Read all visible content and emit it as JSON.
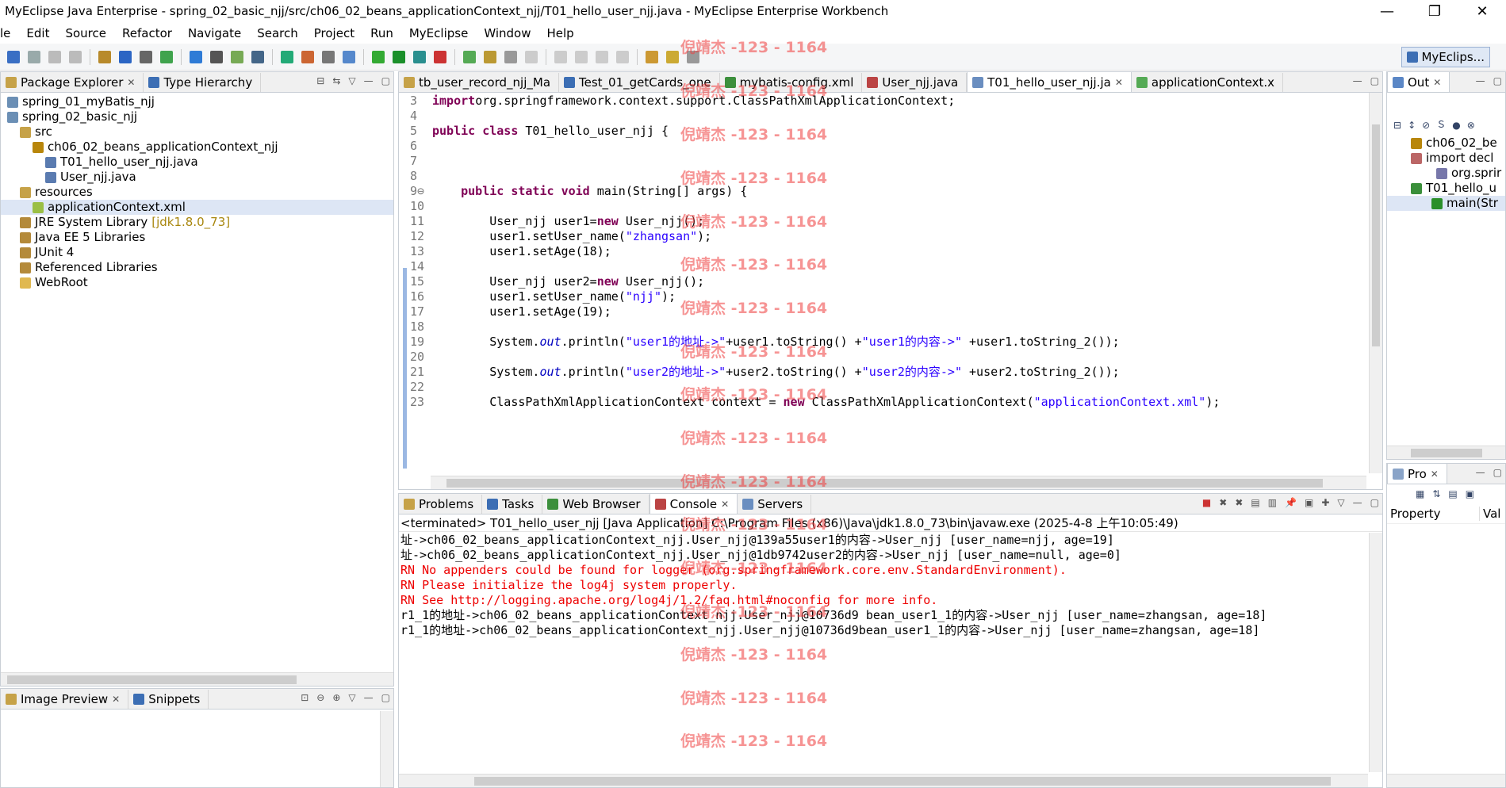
{
  "window": {
    "title": "MyEclipse Java Enterprise - spring_02_basic_njj/src/ch06_02_beans_applicationContext_njj/T01_hello_user_njj.java - MyEclipse Enterprise Workbench",
    "minimize": "—",
    "maximize": "❐",
    "close": "✕"
  },
  "menu": [
    "le",
    "Edit",
    "Source",
    "Refactor",
    "Navigate",
    "Search",
    "Project",
    "Run",
    "MyEclipse",
    "Window",
    "Help"
  ],
  "perspective": {
    "label": "MyEclips..."
  },
  "package_explorer": {
    "tabs": [
      {
        "label": "Package Explorer",
        "close": "✕"
      },
      {
        "label": "Type Hierarchy"
      }
    ],
    "tree": [
      {
        "label": "spring_01_myBatis_njj",
        "indent": 0,
        "icon": "project-icon"
      },
      {
        "label": "spring_02_basic_njj",
        "indent": 0,
        "icon": "project-icon"
      },
      {
        "label": "src",
        "indent": 1,
        "icon": "source-folder-icon"
      },
      {
        "label": "ch06_02_beans_applicationContext_njj",
        "indent": 2,
        "icon": "package-icon"
      },
      {
        "label": "T01_hello_user_njj.java",
        "indent": 3,
        "icon": "java-file-icon"
      },
      {
        "label": "User_njj.java",
        "indent": 3,
        "icon": "java-file-icon"
      },
      {
        "label": "resources",
        "indent": 1,
        "icon": "source-folder-icon"
      },
      {
        "label": "applicationContext.xml",
        "indent": 2,
        "icon": "xml-file-icon",
        "selected": true
      },
      {
        "label": "JRE System Library",
        "suffix": "[jdk1.8.0_73]",
        "indent": 1,
        "icon": "library-icon"
      },
      {
        "label": "Java EE 5 Libraries",
        "indent": 1,
        "icon": "library-icon"
      },
      {
        "label": "JUnit 4",
        "indent": 1,
        "icon": "library-icon"
      },
      {
        "label": "Referenced Libraries",
        "indent": 1,
        "icon": "library-icon"
      },
      {
        "label": "WebRoot",
        "indent": 1,
        "icon": "folder-icon"
      }
    ]
  },
  "image_preview": {
    "tabs": [
      {
        "label": "Image Preview",
        "close": "✕"
      },
      {
        "label": "Snippets"
      }
    ]
  },
  "editor": {
    "tabs": [
      {
        "label": "tb_user_record_njj_Ma"
      },
      {
        "label": "Test_01_getCards_one"
      },
      {
        "label": "mybatis-config.xml"
      },
      {
        "label": "User_njj.java"
      },
      {
        "label": "T01_hello_user_njj.ja",
        "active": true,
        "close": "✕"
      },
      {
        "label": "applicationContext.x"
      }
    ],
    "lines": [
      {
        "n": "3",
        "parts": [
          [
            "kw",
            "import"
          ],
          [
            "",
            "org.springframework.context.support.ClassPathXmlApplicationContext;"
          ]
        ]
      },
      {
        "n": "4",
        "parts": []
      },
      {
        "n": "5",
        "parts": [
          [
            "kw",
            "public"
          ],
          [
            "",
            " "
          ],
          [
            "kw",
            "class"
          ],
          [
            "",
            " T01_hello_user_njj {"
          ]
        ]
      },
      {
        "n": "6",
        "parts": []
      },
      {
        "n": "7",
        "parts": []
      },
      {
        "n": "8",
        "parts": []
      },
      {
        "n": "9⊖",
        "parts": [
          [
            "",
            "    "
          ],
          [
            "kw",
            "public"
          ],
          [
            "",
            " "
          ],
          [
            "kw",
            "static"
          ],
          [
            "",
            " "
          ],
          [
            "kw",
            "void"
          ],
          [
            "",
            " main(String[] args) {"
          ]
        ]
      },
      {
        "n": "10",
        "parts": []
      },
      {
        "n": "11",
        "parts": [
          [
            "",
            "        User_njj user1="
          ],
          [
            "kw",
            "new"
          ],
          [
            "",
            " User_njj();"
          ]
        ]
      },
      {
        "n": "12",
        "parts": [
          [
            "",
            "        user1.setUser_name("
          ],
          [
            "str",
            "\"zhangsan\""
          ],
          [
            "",
            ");"
          ]
        ]
      },
      {
        "n": "13",
        "parts": [
          [
            "",
            "        user1.setAge(18);"
          ]
        ]
      },
      {
        "n": "14",
        "parts": []
      },
      {
        "n": "15",
        "parts": [
          [
            "",
            "        User_njj user2="
          ],
          [
            "kw",
            "new"
          ],
          [
            "",
            " User_njj();"
          ]
        ]
      },
      {
        "n": "16",
        "parts": [
          [
            "",
            "        user1.setUser_name("
          ],
          [
            "str",
            "\"njj\""
          ],
          [
            "",
            ");"
          ]
        ]
      },
      {
        "n": "17",
        "parts": [
          [
            "",
            "        user1.setAge(19);"
          ]
        ]
      },
      {
        "n": "18",
        "parts": []
      },
      {
        "n": "19",
        "parts": [
          [
            "",
            "        System."
          ],
          [
            "it",
            "out"
          ],
          [
            "",
            ".println("
          ],
          [
            "str",
            "\"user1的地址->\""
          ],
          [
            "",
            "+user1.toString() +"
          ],
          [
            "str",
            "\"user1的内容->\""
          ],
          [
            "",
            " +user1.toString_2());"
          ]
        ]
      },
      {
        "n": "20",
        "parts": []
      },
      {
        "n": "21",
        "parts": [
          [
            "",
            "        System."
          ],
          [
            "it",
            "out"
          ],
          [
            "",
            ".println("
          ],
          [
            "str",
            "\"user2的地址->\""
          ],
          [
            "",
            "+user2.toString() +"
          ],
          [
            "str",
            "\"user2的内容->\""
          ],
          [
            "",
            " +user2.toString_2());"
          ]
        ]
      },
      {
        "n": "22",
        "parts": []
      },
      {
        "n": "23",
        "parts": [
          [
            "",
            "        ClassPathXmlApplicationContext context = "
          ],
          [
            "kw",
            "new"
          ],
          [
            "",
            " ClassPathXmlApplicationContext("
          ],
          [
            "str",
            "\"applicationContext.xml\""
          ],
          [
            "",
            ");"
          ]
        ]
      }
    ]
  },
  "bottom": {
    "tabs": [
      {
        "label": "Problems"
      },
      {
        "label": "Tasks"
      },
      {
        "label": "Web Browser"
      },
      {
        "label": "Console",
        "active": true,
        "close": "✕"
      },
      {
        "label": "Servers"
      }
    ],
    "header": "<terminated> T01_hello_user_njj [Java Application] C:\\Program Files (x86)\\Java\\jdk1.8.0_73\\bin\\javaw.exe (2025-4-8 上午10:05:49)",
    "lines": [
      {
        "text": "址->ch06_02_beans_applicationContext_njj.User_njj@139a55user1的内容->User_njj [user_name=njj, age=19]",
        "err": false
      },
      {
        "text": "址->ch06_02_beans_applicationContext_njj.User_njj@1db9742user2的内容->User_njj [user_name=null, age=0]",
        "err": false
      },
      {
        "text": "RN No appenders could be found for logger (org.springframework.core.env.StandardEnvironment).",
        "err": true
      },
      {
        "text": "RN Please initialize the log4j system properly.",
        "err": true
      },
      {
        "text": "RN See http://logging.apache.org/log4j/1.2/faq.html#noconfig for more info.",
        "err": true
      },
      {
        "text": "r1_1的地址->ch06_02_beans_applicationContext_njj.User_njj@10736d9 bean_user1_1的内容->User_njj [user_name=zhangsan, age=18]",
        "err": false
      },
      {
        "text": "r1_1的地址->ch06_02_beans_applicationContext_njj.User_njj@10736d9bean_user1_1的内容->User_njj [user_name=zhangsan, age=18]",
        "err": false
      }
    ]
  },
  "outline": {
    "tab": "Out",
    "close": "✕",
    "items": [
      {
        "label": "ch06_02_be",
        "icon": "package-icon"
      },
      {
        "label": "import decl",
        "icon": "import-icon"
      },
      {
        "label": "org.sprir",
        "icon": "import-item-icon"
      },
      {
        "label": "T01_hello_u",
        "icon": "class-icon"
      },
      {
        "label": "main(Str",
        "icon": "method-icon"
      }
    ]
  },
  "properties": {
    "tab": "Pro",
    "close": "✕",
    "col_property": "Property",
    "col_value": "Val"
  },
  "watermark": "倪靖杰 -123 - 1164",
  "colors": {
    "keyword": "#7f0055",
    "string": "#2a00ff",
    "field": "#0000c0",
    "error": "#e00000",
    "watermark": "#ee3c3c"
  }
}
